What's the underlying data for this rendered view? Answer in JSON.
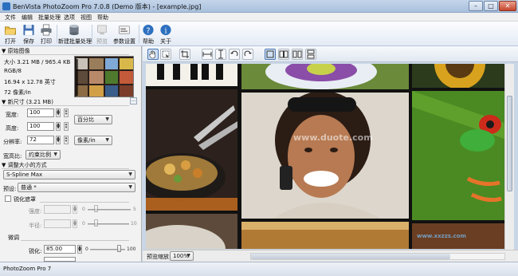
{
  "window": {
    "title": "BenVista PhotoZoom Pro 7.0.8 (Demo 版本) - [example.jpg]",
    "minimize": "–",
    "maximize": "□",
    "close": "✕"
  },
  "menu": [
    "文件",
    "编辑",
    "批量处理",
    "选项",
    "视图",
    "帮助"
  ],
  "toolbar": {
    "open": "打开",
    "save": "保存",
    "print": "打印",
    "batch": "新建批量处理",
    "preview": "预览",
    "params": "参数设置",
    "help": "帮助",
    "about": "关于"
  },
  "original": {
    "header": "原始图像",
    "size": "大小 3.21 MB / 965.4 KB",
    "mode": "RGB/8",
    "dims": "16.94 x 12.78 英寸",
    "res": "72 像素/in"
  },
  "newsize": {
    "header": "新尺寸 (3.21 MB)",
    "width_label": "宽度:",
    "width_value": "100",
    "height_label": "高度:",
    "height_value": "100",
    "unit": "百分比",
    "res_label": "分辨率:",
    "res_value": "72",
    "res_unit": "像素/in",
    "aspect_label": "宽高比:",
    "aspect_value": "约束比例"
  },
  "resize": {
    "header": "调整大小的方式",
    "method": "S-Spline Max",
    "preset_label": "预设:",
    "preset_value": "普通 *"
  },
  "sharpen": {
    "unsharp_label": "锐化遮罩",
    "strength_label": "强度:",
    "radius_label": "半径:",
    "strength_min": "0",
    "strength_max": "5",
    "radius_min": "0",
    "radius_max": "10",
    "fine_header": "微调",
    "sharp_label": "锐化:",
    "sharp_value": "85.00",
    "sharp_min": "0",
    "sharp_max": "100",
    "sharp_level": 0.85
  },
  "viewer": {
    "zoom_label": "预览缩放:",
    "zoom_value": "100%"
  },
  "status": {
    "text": "PhotoZoom Pro 7"
  },
  "watermarks": {
    "center": "www.duote.com",
    "corner": "www.xxzzs.com"
  },
  "colors": {
    "accent": "#2d6fbf",
    "toolbar_bg": "#e4ebf5",
    "canvas_bg": "#111111"
  }
}
